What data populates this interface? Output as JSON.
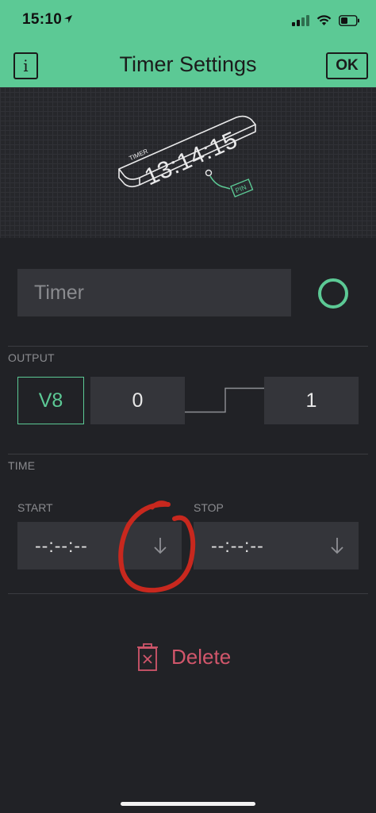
{
  "status_bar": {
    "time": "15:10"
  },
  "header": {
    "title": "Timer Settings",
    "info_label": "i",
    "ok_label": "OK"
  },
  "illustration": {
    "device_label": "TIMER",
    "display_time": "13:14:15",
    "pin_label": "PIN"
  },
  "name_field": {
    "placeholder": "Timer"
  },
  "output": {
    "section_label": "OUTPUT",
    "pin": "V8",
    "min_value": "0",
    "max_value": "1"
  },
  "time": {
    "section_label": "TIME",
    "start_label": "START",
    "start_value": "--:--:--",
    "stop_label": "STOP",
    "stop_value": "--:--:--"
  },
  "actions": {
    "delete_label": "Delete"
  },
  "colors": {
    "accent": "#5cc995",
    "danger": "#d1566b",
    "background": "#212226",
    "annotation": "#c8281e"
  }
}
